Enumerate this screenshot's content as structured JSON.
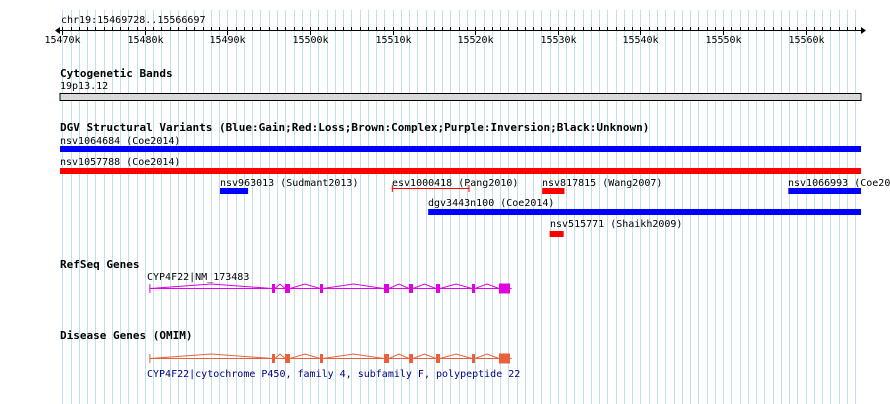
{
  "region": "chr19:15469728..15566697",
  "ruler": {
    "start": 15469728,
    "end": 15566697,
    "tick_labels": [
      "15470k",
      "15480k",
      "15490k",
      "15500k",
      "15510k",
      "15520k",
      "15530k",
      "15540k",
      "15550k",
      "15560k"
    ],
    "tick_values": [
      15470000,
      15480000,
      15490000,
      15500000,
      15510000,
      15520000,
      15530000,
      15540000,
      15550000,
      15560000
    ]
  },
  "colors": {
    "grid_line": "#bfe1ea",
    "gain": "#0000ff",
    "loss": "#ff0000",
    "refseq": "#e000e0",
    "omim": "#e8603c",
    "omim_label": "#000080",
    "band_fill": "#d9d9d9"
  },
  "cytoband": {
    "title": "Cytogenetic Bands",
    "band_name": "19p13.12"
  },
  "dgv": {
    "title": "DGV Structural Variants (Blue:Gain;Red:Loss;Brown:Complex;Purple:Inversion;Black:Unknown)",
    "variants": [
      {
        "label": "nsv1064684 (Coe2014)",
        "type": "gain",
        "start": 15469728,
        "end": 15566697
      },
      {
        "label": "nsv1057788 (Coe2014)",
        "type": "loss",
        "start": 15469728,
        "end": 15566697
      },
      {
        "label": "nsv963013 (Sudmant2013)",
        "type": "gain",
        "start": 15489100,
        "end": 15492500
      },
      {
        "label": "esv1000418 (Pang2010)",
        "type": "loss",
        "start": 15509900,
        "end": 15519300
      },
      {
        "label": "nsv817815 (Wang2007)",
        "type": "loss",
        "start": 15528100,
        "end": 15530800
      },
      {
        "label": "nsv1066993 (Coe20",
        "type": "gain",
        "start": 15557900,
        "end": 15566697
      },
      {
        "label": "dgv3443n100 (Coe2014)",
        "type": "gain",
        "start": 15514300,
        "end": 15566697
      },
      {
        "label": "nsv515771 (Shaikh2009)",
        "type": "loss",
        "start": 15529000,
        "end": 15530700
      }
    ]
  },
  "refseq": {
    "title": "RefSeq Genes",
    "gene_label": "CYP4F22|NM_173483",
    "start": 15480550,
    "end": 15524400
  },
  "omim": {
    "title": "Disease Genes (OMIM)",
    "gene_label": "CYP4F22|cytochrome P450, family 4, subfamily F, polypeptide 22",
    "start": 15480550,
    "end": 15524400
  }
}
